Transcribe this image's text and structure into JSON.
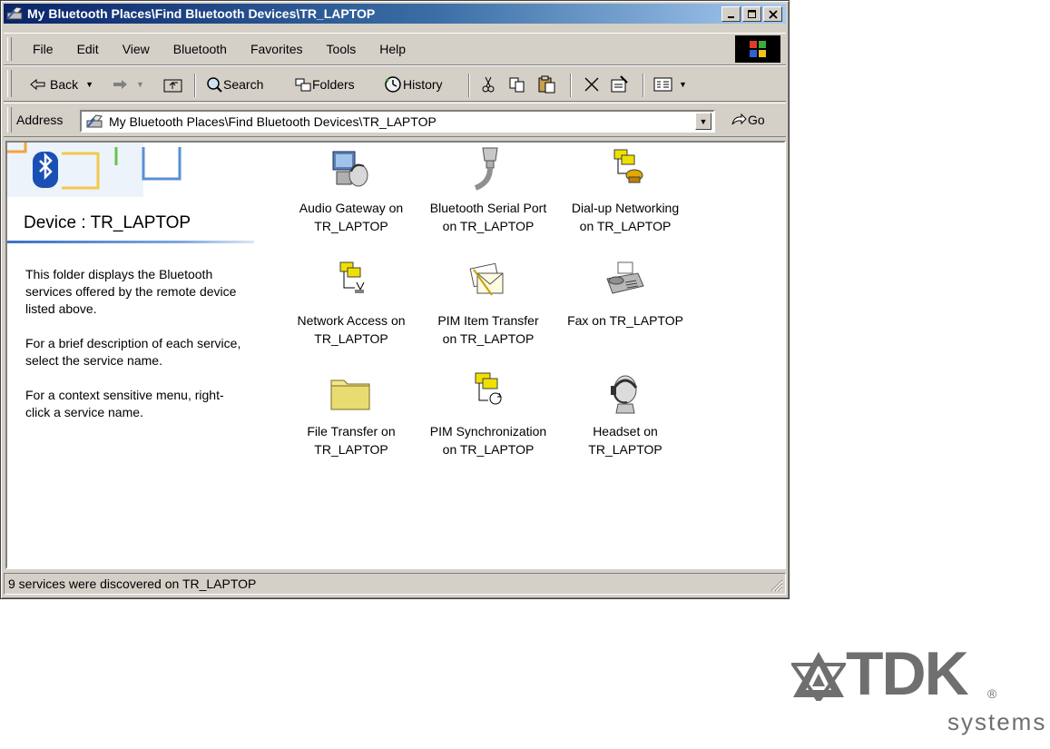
{
  "window": {
    "title": "My Bluetooth Places\\Find Bluetooth Devices\\TR_LAPTOP",
    "controls": [
      "minimize",
      "maximize",
      "close"
    ]
  },
  "menubar": {
    "items": [
      "File",
      "Edit",
      "View",
      "Bluetooth",
      "Favorites",
      "Tools",
      "Help"
    ]
  },
  "toolbar": {
    "back": "Back",
    "search": "Search",
    "folders": "Folders",
    "history": "History"
  },
  "addressbar": {
    "label": "Address",
    "value": "My Bluetooth Places\\Find Bluetooth Devices\\TR_LAPTOP",
    "go": "Go"
  },
  "leftpanel": {
    "title": "Device : TR_LAPTOP",
    "paragraphs": [
      "This folder displays the Bluetooth services offered by the remote device listed above.",
      "For a brief description of each service, select the service name.",
      "For a context sensitive menu, right-click a service name."
    ]
  },
  "services": [
    {
      "line1": "Audio Gateway on",
      "line2": "TR_LAPTOP",
      "icon": "audio-gateway-icon"
    },
    {
      "line1": "Bluetooth Serial Port",
      "line2": "on TR_LAPTOP",
      "icon": "serial-port-icon"
    },
    {
      "line1": "Dial-up Networking",
      "line2": "on TR_LAPTOP",
      "icon": "dialup-networking-icon"
    },
    {
      "line1": "Network Access on",
      "line2": "TR_LAPTOP",
      "icon": "network-access-icon"
    },
    {
      "line1": "PIM Item Transfer",
      "line2": "on TR_LAPTOP",
      "icon": "pim-item-transfer-icon"
    },
    {
      "line1": "Fax on TR_LAPTOP",
      "line2": "",
      "icon": "fax-icon"
    },
    {
      "line1": "File Transfer on",
      "line2": "TR_LAPTOP",
      "icon": "folder-icon"
    },
    {
      "line1": "PIM Synchronization",
      "line2": "on TR_LAPTOP",
      "icon": "pim-sync-icon"
    },
    {
      "line1": "Headset on",
      "line2": "TR_LAPTOP",
      "icon": "headset-icon"
    }
  ],
  "statusbar": {
    "text": "9 services were discovered on TR_LAPTOP"
  },
  "logo": {
    "brand": "TDK",
    "registered": "®",
    "subtitle": "systems"
  },
  "colors": {
    "titlebar": "#0a246a",
    "face": "#d4d0c8",
    "accent": "#3a72c6",
    "logo_gray": "#6f6f6f"
  }
}
